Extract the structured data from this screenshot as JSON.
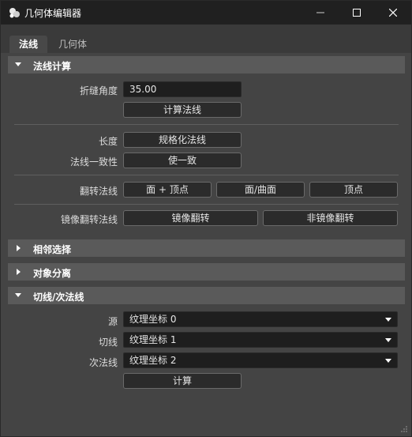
{
  "window": {
    "title": "几何体编辑器",
    "controls": [
      "minimize-icon",
      "maximize-icon",
      "close-icon"
    ]
  },
  "tabs": [
    {
      "label": "法线",
      "active": true
    },
    {
      "label": "几何体",
      "active": false
    }
  ],
  "sections": {
    "normal_calc": {
      "title": "法线计算",
      "expanded": true
    },
    "adjacent_select": {
      "title": "相邻选择",
      "expanded": false
    },
    "object_separate": {
      "title": "对象分离",
      "expanded": false
    },
    "tangent": {
      "title": "切线/次法线",
      "expanded": true
    }
  },
  "normal_calc": {
    "crease_angle_label": "折缝角度",
    "crease_angle_value": "35.00",
    "compute_button": "计算法线",
    "length_label": "长度",
    "normalize_button": "规格化法线",
    "consistency_label": "法线一致性",
    "unify_button": "使一致",
    "flip_label": "翻转法线",
    "flip_face_vertex": "面 + 顶点",
    "flip_face_surface": "面/曲面",
    "flip_vertex": "顶点",
    "mirror_label": "镜像翻转法线",
    "mirror_flip": "镜像翻转",
    "non_mirror_flip": "非镜像翻转"
  },
  "tangent": {
    "source_label": "源",
    "source_value": "纹理坐标 0",
    "tangent_label": "切线",
    "tangent_value": "纹理坐标 1",
    "binormal_label": "次法线",
    "binormal_value": "纹理坐标 2",
    "compute_button": "计算"
  },
  "colors": {
    "background": "#444444",
    "titlebar": "#202020",
    "section_header": "#5a5a5a",
    "field": "#1e1e1e",
    "button": "#2b2b2b"
  }
}
